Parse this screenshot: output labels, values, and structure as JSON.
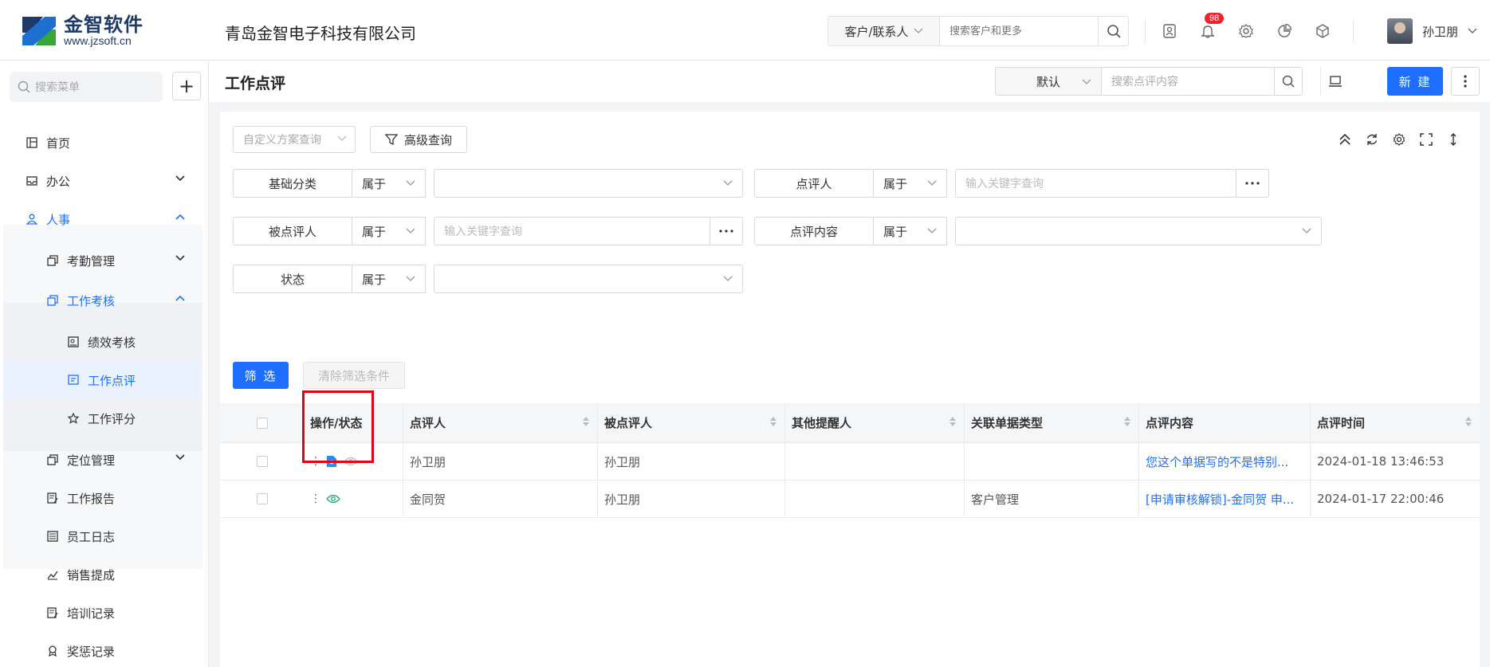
{
  "brand": {
    "name": "金智软件",
    "url": "www.jzsoft.cn",
    "color": "#1d3a6b"
  },
  "company": "青岛金智电子科技有限公司",
  "top_search": {
    "scope": "客户/联系人",
    "placeholder": "搜索客户和更多"
  },
  "notifications": {
    "count": "98"
  },
  "user": {
    "name": "孙卫朋"
  },
  "sidebar": {
    "search_placeholder": "搜索菜单",
    "add_label": "+",
    "items": [
      {
        "label": "首页"
      },
      {
        "label": "办公"
      },
      {
        "label": "人事"
      },
      {
        "label": "考勤管理"
      },
      {
        "label": "工作考核"
      },
      {
        "label": "绩效考核"
      },
      {
        "label": "工作点评"
      },
      {
        "label": "工作评分"
      },
      {
        "label": "定位管理"
      },
      {
        "label": "工作报告"
      },
      {
        "label": "员工日志"
      },
      {
        "label": "销售提成"
      },
      {
        "label": "培训记录"
      },
      {
        "label": "奖惩记录"
      }
    ]
  },
  "page": {
    "title": "工作点评",
    "view": "默认",
    "search_placeholder": "搜索点评内容",
    "new_label": "新 建"
  },
  "query": {
    "plan_placeholder": "自定义方案查询",
    "advanced_label": "高级查询",
    "filters": [
      {
        "label": "基础分类",
        "op": "属于",
        "value": ""
      },
      {
        "label": "点评人",
        "op": "属于",
        "placeholder": "输入关键字查询"
      },
      {
        "label": "被点评人",
        "op": "属于",
        "placeholder": "输入关键字查询"
      },
      {
        "label": "点评内容",
        "op": "属于",
        "value": ""
      },
      {
        "label": "状态",
        "op": "属于",
        "value": ""
      }
    ],
    "filter_btn": "筛 选",
    "clear_btn": "清除筛选条件"
  },
  "table": {
    "columns": [
      "操作/状态",
      "点评人",
      "被点评人",
      "其他提醒人",
      "关联单据类型",
      "点评内容",
      "点评时间"
    ],
    "rows": [
      {
        "reviewer": "孙卫朋",
        "reviewee": "孙卫朋",
        "others": "",
        "doc_type": "",
        "content": "您这个单据写的不是特别...",
        "time": "2024-01-18 13:46:53"
      },
      {
        "reviewer": "金同贺",
        "reviewee": "孙卫朋",
        "others": "",
        "doc_type": "客户管理",
        "content": "[申请审核解锁]-金同贺 申...",
        "time": "2024-01-17 22:00:46"
      }
    ]
  },
  "colors": {
    "accent": "#1e6fff",
    "highlight": "#e60012",
    "badge": "#f5222d",
    "viewed": "#2db37a"
  }
}
